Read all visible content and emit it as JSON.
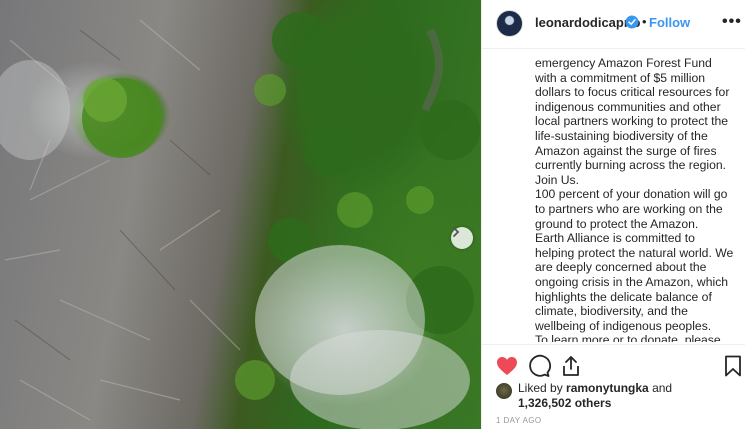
{
  "post": {
    "username": "leonardodicaprio",
    "separator": "•",
    "follow_label": "Follow",
    "more_label": "•••",
    "caption_lines": [
      "emergency Amazon Forest Fund with a commitment of $5 million dollars to focus critical resources for indigenous communities and other local partners working to protect the life-sustaining biodiversity of the Amazon against the surge of fires currently burning across the region.",
      "Join Us.",
      "100 percent of your donation will go to partners who are working on the ground to protect the Amazon.",
      "Earth Alliance is committed to helping protect the natural world. We are deeply concerned about the ongoing crisis in the Amazon, which highlights the delicate balance of climate, biodiversity, and the wellbeing of indigenous peoples.",
      "To learn more or to donate, please"
    ],
    "liked_by_prefix": "Liked by",
    "liked_by_user": "ramonytungka",
    "liked_by_and": "and",
    "like_count": "1,326,502 others",
    "timestamp": "1 DAY AGO"
  },
  "icons": {
    "like": "heart-filled-icon",
    "comment": "comment-bubble-icon",
    "share": "share-arrow-icon",
    "save": "bookmark-icon",
    "verified": "verified-badge-icon",
    "next": "chevron-right-icon"
  },
  "colors": {
    "like_red": "#ed4956",
    "follow_blue": "#3897f0",
    "verified_blue": "#3897f0",
    "timestamp_gray": "#999999"
  }
}
